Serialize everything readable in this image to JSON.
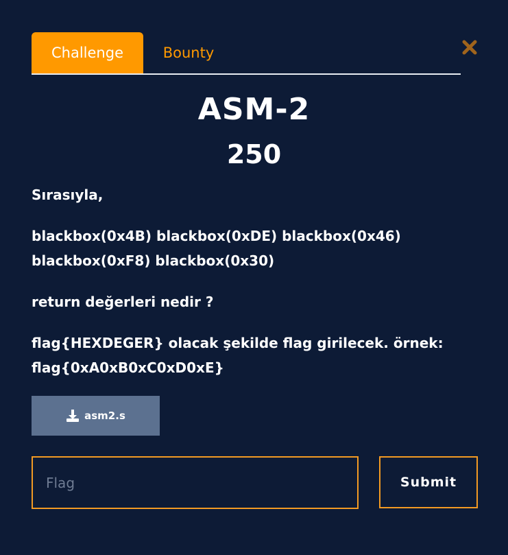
{
  "tabs": {
    "challenge_label": "Challenge",
    "bounty_label": "Bounty"
  },
  "challenge": {
    "title": "ASM-2",
    "points": "250",
    "description": {
      "line1": "Sırasıyla,",
      "line2": "blackbox(0x4B) blackbox(0xDE) blackbox(0x46) blackbox(0xF8) blackbox(0x30)",
      "line3": "return değerleri nedir ?",
      "line4": "flag{HEXDEGER} olacak şekilde flag girilecek. örnek: flag{0xA0xB0xC0xD0xE}"
    },
    "file": {
      "name": "asm2.s",
      "icon": "download-icon"
    }
  },
  "form": {
    "flag_value": "",
    "flag_placeholder": "Flag",
    "submit_label": "Submit"
  },
  "icons": {
    "close": "close-icon"
  },
  "colors": {
    "background": "#0d1b36",
    "accent": "#ff9900",
    "file_button": "#5c7190",
    "close_icon": "#a0641c"
  }
}
